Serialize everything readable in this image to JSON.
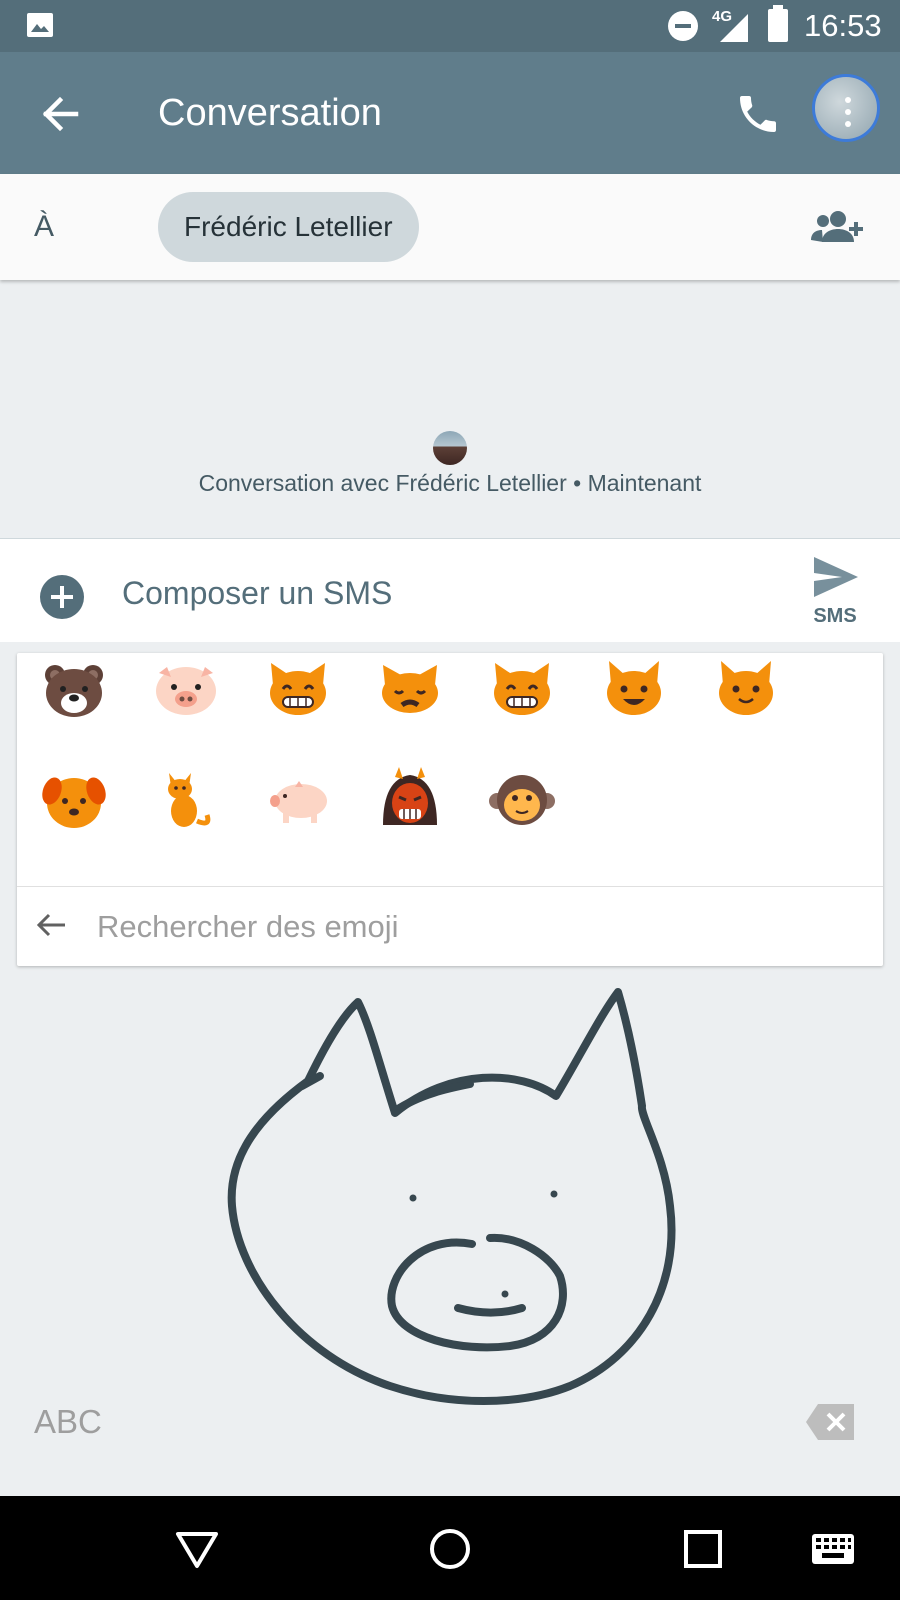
{
  "status_bar": {
    "network": "4G",
    "time": "16:53",
    "icons": [
      "image-notification-icon",
      "do-not-disturb-icon",
      "signal-icon",
      "battery-icon"
    ]
  },
  "app_bar": {
    "title": "Conversation",
    "icons": [
      "back-arrow-icon",
      "phone-icon",
      "contact-avatar"
    ]
  },
  "recipient": {
    "label": "À",
    "chip": "Frédéric Letellier",
    "icon": "add-person-icon"
  },
  "conversation": {
    "info": "Conversation avec Frédéric Letellier • Maintenant"
  },
  "compose": {
    "placeholder": "Composer un SMS",
    "send_label": "SMS",
    "icons": [
      "add-circle-icon",
      "send-icon"
    ]
  },
  "emoji_results": {
    "items": [
      "🐻",
      "🐷",
      "😸",
      "😾",
      "😸",
      "🐱",
      "😺",
      "🐶",
      "🐈",
      "🐖",
      "👹",
      "🐵"
    ],
    "search_placeholder": "Rechercher des emoji"
  },
  "keyboard": {
    "mode_label": "ABC",
    "icons": [
      "backspace-icon"
    ]
  },
  "nav_bar": {
    "icons": [
      "back-triangle-icon",
      "home-circle-icon",
      "recents-square-icon",
      "keyboard-icon"
    ]
  },
  "colors": {
    "status_bar": "#546e7a",
    "app_bar": "#607d8b",
    "background": "#eceff1",
    "chip": "#cfd8dc",
    "ink": "#37474f"
  }
}
